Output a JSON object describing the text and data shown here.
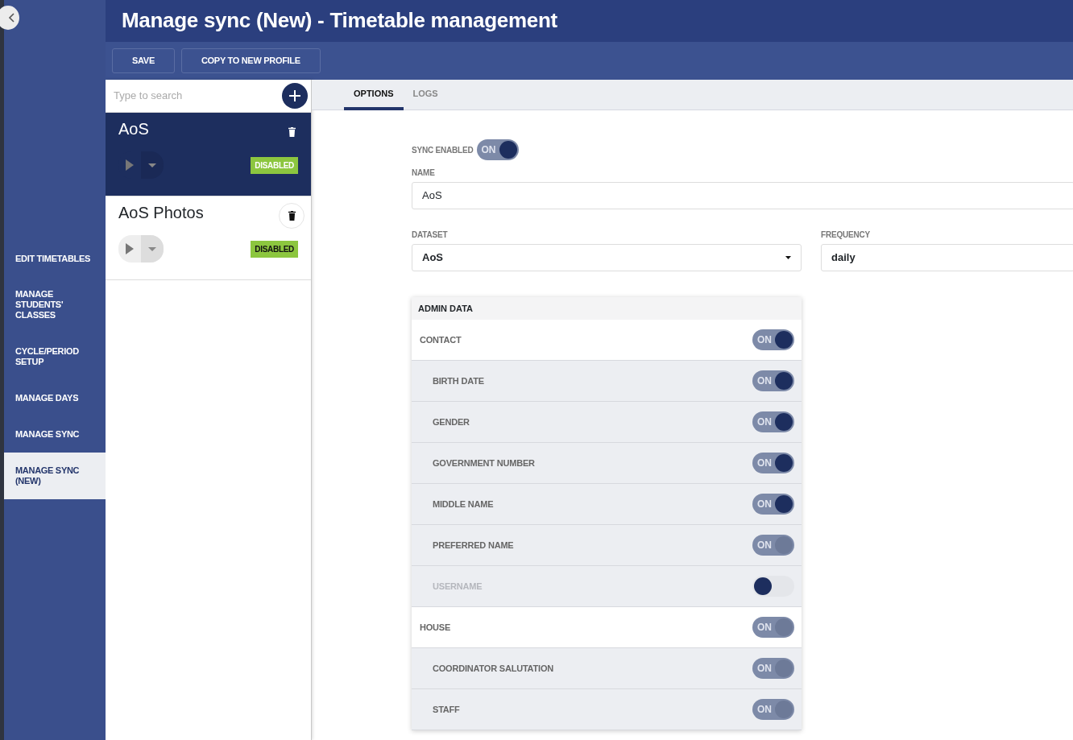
{
  "page_title": "Manage sync (New) - Timetable management",
  "toolbar": [
    "SAVE",
    "COPY TO NEW PROFILE"
  ],
  "sidebar": {
    "items": [
      {
        "label": "EDIT TIMETABLES",
        "selected": false
      },
      {
        "label": "MANAGE STUDENTS' CLASSES",
        "selected": false
      },
      {
        "label": "CYCLE/PERIOD SETUP",
        "selected": false
      },
      {
        "label": "MANAGE DAYS",
        "selected": false
      },
      {
        "label": "MANAGE SYNC",
        "selected": false
      },
      {
        "label": "MANAGE SYNC (NEW)",
        "selected": true
      }
    ]
  },
  "profiles": {
    "search": {
      "placeholder": "Type to search"
    },
    "items": [
      {
        "name": "AoS",
        "status": "DISABLED",
        "selected": true
      },
      {
        "name": "AoS Photos",
        "status": "DISABLED",
        "selected": false
      }
    ]
  },
  "tabs": [
    {
      "label": "OPTIONS",
      "selected": true
    },
    {
      "label": "LOGS",
      "selected": false
    }
  ],
  "options": {
    "sync_enabled": {
      "label": "SYNC ENABLED",
      "on": true,
      "text": "ON"
    },
    "name": {
      "label": "NAME",
      "value": "AoS"
    },
    "dataset": {
      "label": "DATASET",
      "value": "AoS"
    },
    "frequency": {
      "label": "FREQUENCY",
      "value": "daily"
    },
    "admin_data": {
      "title": "ADMIN DATA",
      "rows": [
        {
          "kind": "group",
          "label": "CONTACT",
          "on": true,
          "text": "ON"
        },
        {
          "kind": "field",
          "label": "BIRTH DATE",
          "on": true,
          "text": "ON"
        },
        {
          "kind": "field",
          "label": "GENDER",
          "on": true,
          "text": "ON"
        },
        {
          "kind": "field",
          "label": "GOVERNMENT NUMBER",
          "on": true,
          "text": "ON"
        },
        {
          "kind": "field",
          "label": "MIDDLE NAME",
          "on": true,
          "text": "ON"
        },
        {
          "kind": "field",
          "label": "PREFERRED NAME",
          "on": true,
          "text": "ON"
        },
        {
          "kind": "field",
          "label": "USERNAME",
          "on": false
        },
        {
          "kind": "group",
          "label": "HOUSE",
          "on": true,
          "text": "ON"
        },
        {
          "kind": "field",
          "label": "COORDINATOR SALUTATION",
          "on": true,
          "text": "ON"
        },
        {
          "kind": "field",
          "label": "STAFF",
          "on": true,
          "text": "ON"
        }
      ]
    }
  }
}
